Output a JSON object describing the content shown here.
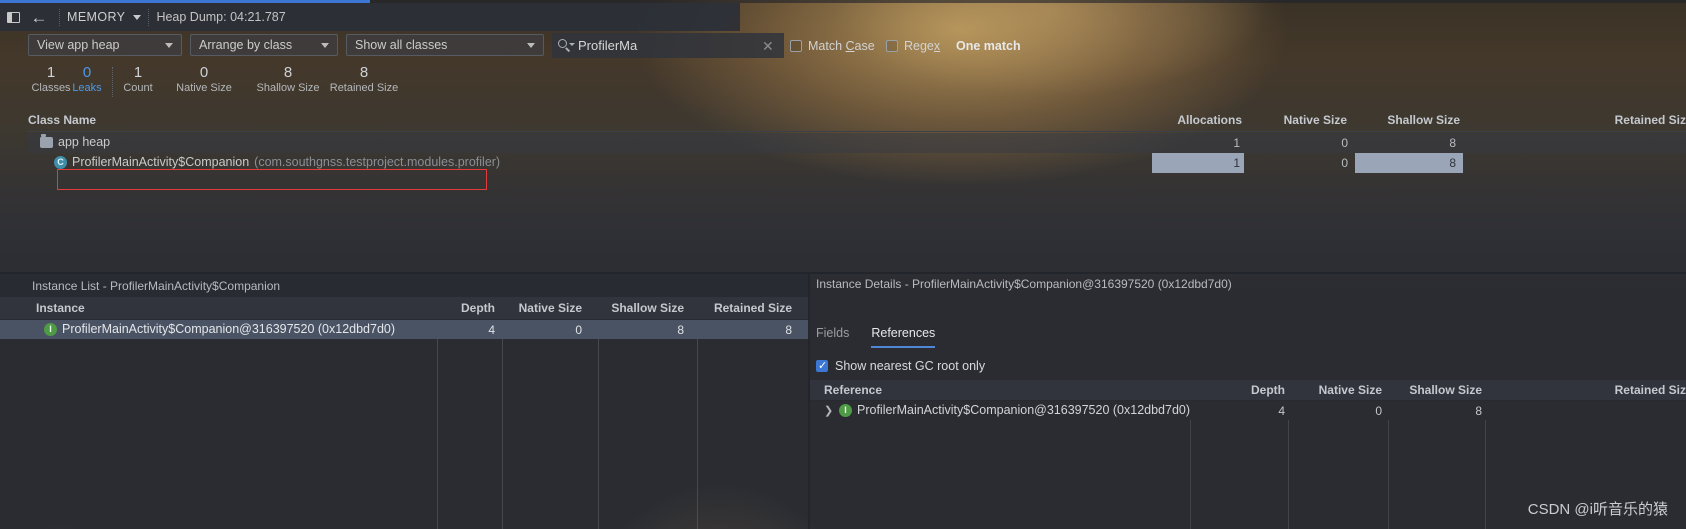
{
  "toolbar": {
    "panel_toggle_icon": "panel-left-icon",
    "back_icon": "back-arrow-icon",
    "memory_label": "MEMORY",
    "memory_caret_icon": "chevron-down-icon",
    "heap_dump_label": "Heap Dump: 04:21.787"
  },
  "filters": {
    "heap_select": "View app heap",
    "arrange_select": "Arrange by class",
    "classes_select": "Show all classes",
    "dropdown_icon": "chevron-down-icon"
  },
  "search": {
    "icon": "search-icon",
    "value": "ProfilerMa",
    "clear_icon": "close-icon",
    "match_case_label": "Match Case",
    "match_case_checked": false,
    "regex_label": "Regex",
    "regex_checked": false,
    "result_label": "One match"
  },
  "stats": [
    {
      "num": "1",
      "label": "Classes",
      "accent": false
    },
    {
      "num": "0",
      "label": "Leaks",
      "accent": true
    },
    {
      "num": "1",
      "label": "Count",
      "accent": false
    },
    {
      "num": "0",
      "label": "Native Size",
      "accent": false
    },
    {
      "num": "8",
      "label": "Shallow Size",
      "accent": false
    },
    {
      "num": "8",
      "label": "Retained Size",
      "accent": false
    }
  ],
  "class_table": {
    "headers": {
      "class_name": "Class Name",
      "allocations": "Allocations",
      "native_size": "Native Size",
      "shallow_size": "Shallow Size",
      "retained_size": "Retained Siz"
    },
    "rows": [
      {
        "icon": "folder-icon",
        "label": "app heap",
        "package": "",
        "allocations": "1",
        "native_size": "0",
        "shallow_size": "8",
        "retained_size": ""
      },
      {
        "icon": "class-icon",
        "label": "ProfilerMainActivity$Companion",
        "package": "(com.southgnss.testproject.modules.profiler)",
        "allocations": "1",
        "native_size": "0",
        "shallow_size": "8",
        "retained_size": ""
      }
    ]
  },
  "instance_list": {
    "title": "Instance List - ProfilerMainActivity$Companion",
    "headers": {
      "instance": "Instance",
      "depth": "Depth",
      "native_size": "Native Size",
      "shallow_size": "Shallow Size",
      "retained_size": "Retained Size"
    },
    "rows": [
      {
        "icon": "instance-icon",
        "label": "ProfilerMainActivity$Companion@316397520 (0x12dbd7d0)",
        "depth": "4",
        "native_size": "0",
        "shallow_size": "8",
        "retained_size": "8"
      }
    ]
  },
  "instance_details": {
    "title": "Instance Details - ProfilerMainActivity$Companion@316397520 (0x12dbd7d0)",
    "tabs": [
      {
        "label": "Fields",
        "active": false
      },
      {
        "label": "References",
        "active": true
      }
    ],
    "gc_root_checkbox": {
      "label": "Show nearest GC root only",
      "checked": true,
      "icon": "checkbox-checked-icon"
    },
    "headers": {
      "reference": "Reference",
      "depth": "Depth",
      "native_size": "Native Size",
      "shallow_size": "Shallow Size",
      "retained_size": "Retained Siz"
    },
    "rows": [
      {
        "expand_icon": "chevron-right-icon",
        "icon": "instance-icon",
        "label": "ProfilerMainActivity$Companion@316397520 (0x12dbd7d0)",
        "depth": "4",
        "native_size": "0",
        "shallow_size": "8",
        "retained_size": ""
      }
    ]
  },
  "watermark": "CSDN @i听音乐的猿",
  "colors": {
    "accent": "#3c77d4",
    "leak_accent": "#4d9ae8",
    "annotation": "#e23b3b",
    "selection": "#4a5364"
  }
}
